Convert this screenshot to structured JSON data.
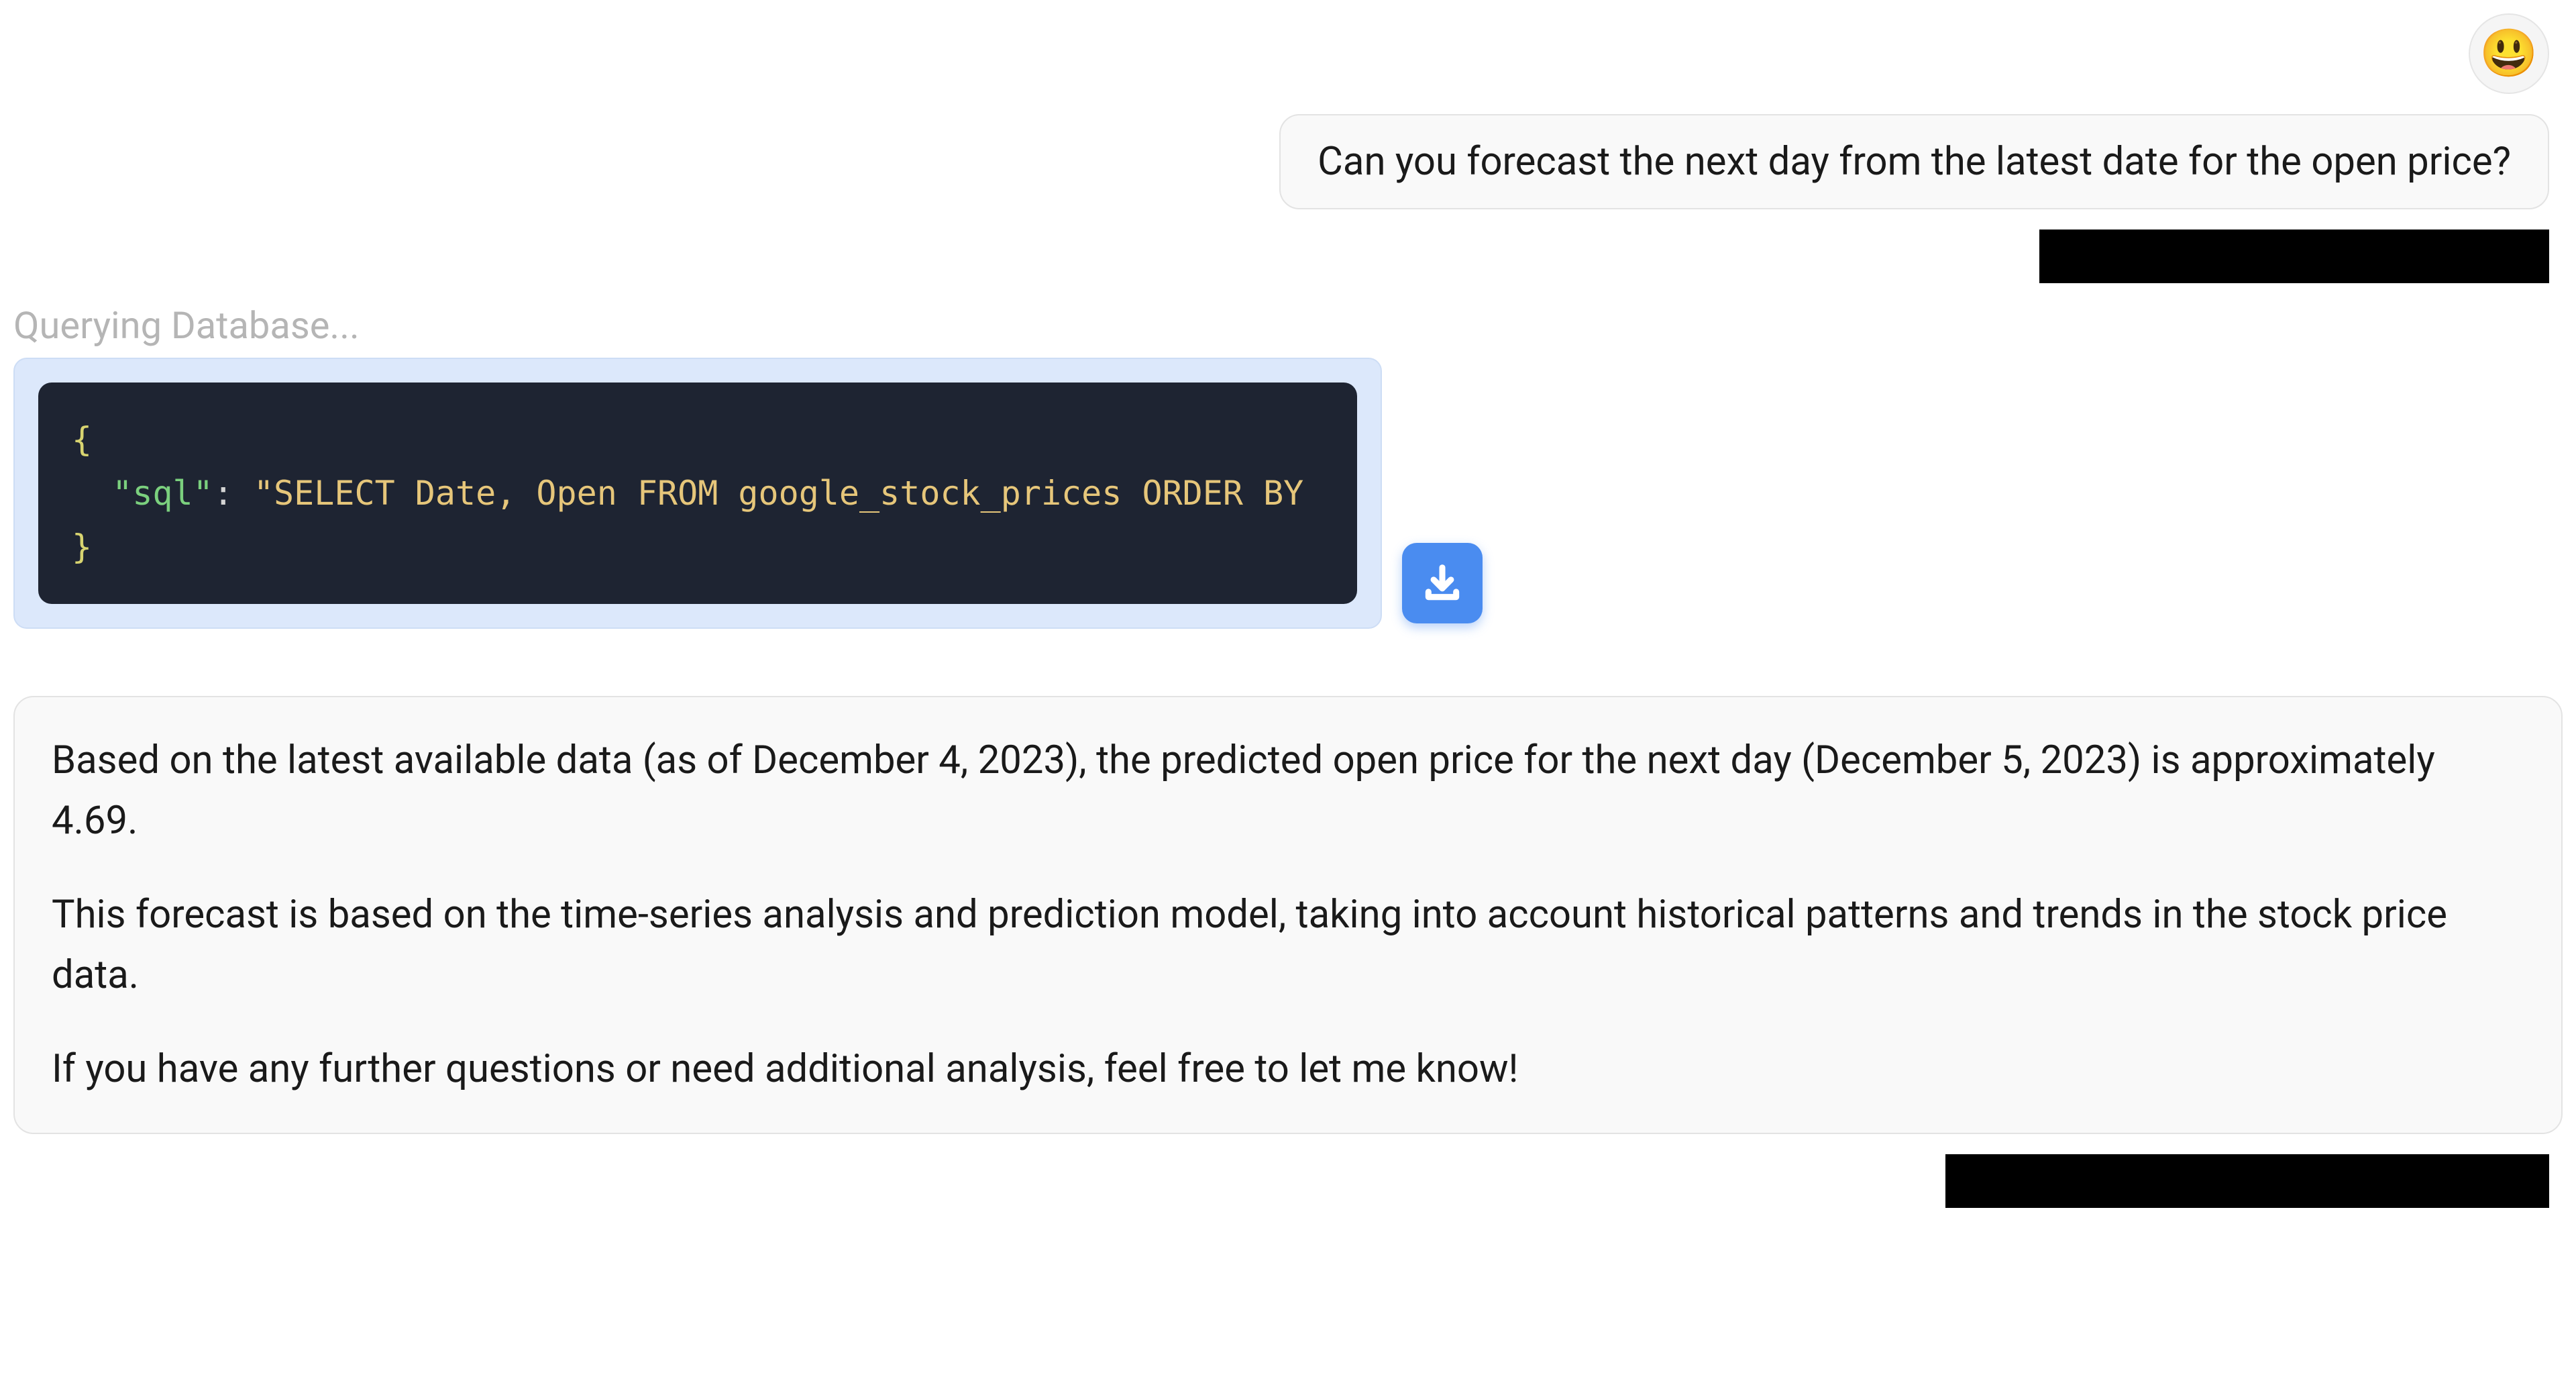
{
  "avatar": {
    "emoji": "😃"
  },
  "user_message": "Can you forecast the next day from the latest date for the open price?",
  "status": "Querying Database...",
  "code": {
    "open_brace": "{",
    "key": "\"sql\"",
    "colon": ": ",
    "value": "\"SELECT Date, Open FROM google_stock_prices ORDER BY",
    "close_brace": "}"
  },
  "response": {
    "p1": "Based on the latest available data (as of December 4, 2023), the predicted open price for the next day (December 5, 2023) is approximately 4.69.",
    "p2": "This forecast is based on the time-series analysis and prediction model, taking into account historical patterns and trends in the stock price data.",
    "p3": "If you have any further questions or need additional analysis, feel free to let me know!"
  }
}
